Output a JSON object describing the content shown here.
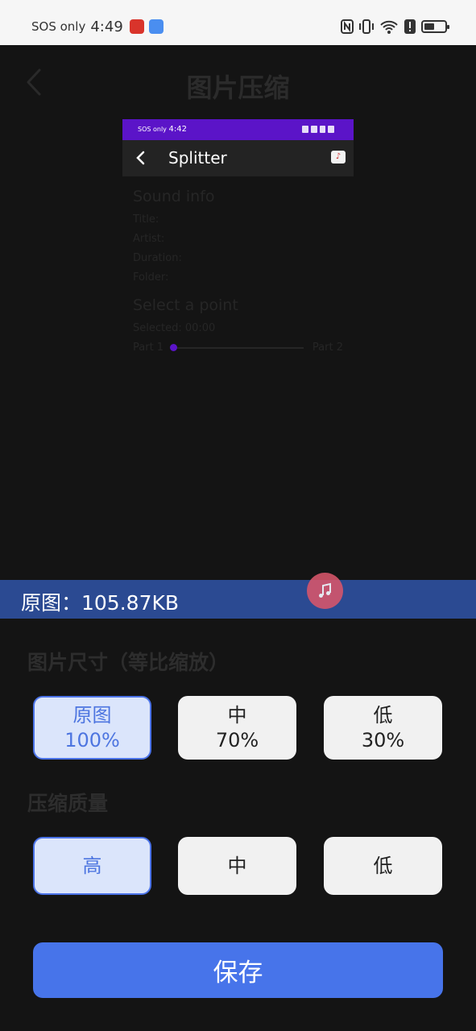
{
  "status_bar": {
    "carrier": "SOS only",
    "time": "4:49",
    "nfc_label": "N",
    "battery_level": 0.5
  },
  "header": {
    "title": "图片压缩"
  },
  "preview": {
    "status_carrier": "SOS only",
    "status_time": "4:42",
    "toolbar_title": "Splitter",
    "sound_info_heading": "Sound info",
    "fields": [
      "Title:",
      "Artist:",
      "Duration:",
      "Folder:"
    ],
    "select_point_heading": "Select a point",
    "selected_label": "Selected: 00:00",
    "part1_label": "Part 1",
    "part2_label": "Part 2",
    "slider_position": 0
  },
  "info": {
    "original_size_label": "原图：105.87KB"
  },
  "size_section": {
    "title": "图片尺寸（等比缩放）",
    "options": [
      {
        "name": "原图",
        "percent": "100%",
        "selected": true
      },
      {
        "name": "中",
        "percent": "70%",
        "selected": false
      },
      {
        "name": "低",
        "percent": "30%",
        "selected": false
      }
    ]
  },
  "quality_section": {
    "title": "压缩质量",
    "options": [
      {
        "name": "高",
        "selected": true
      },
      {
        "name": "中",
        "selected": false
      },
      {
        "name": "低",
        "selected": false
      }
    ]
  },
  "save_button": {
    "label": "保存"
  },
  "colors": {
    "accent": "#4774ea",
    "info_bar": "#2b4a92",
    "selected_fill": "#dbe5fb",
    "preview_status": "#5b14c8",
    "fab": "#d8566b"
  }
}
